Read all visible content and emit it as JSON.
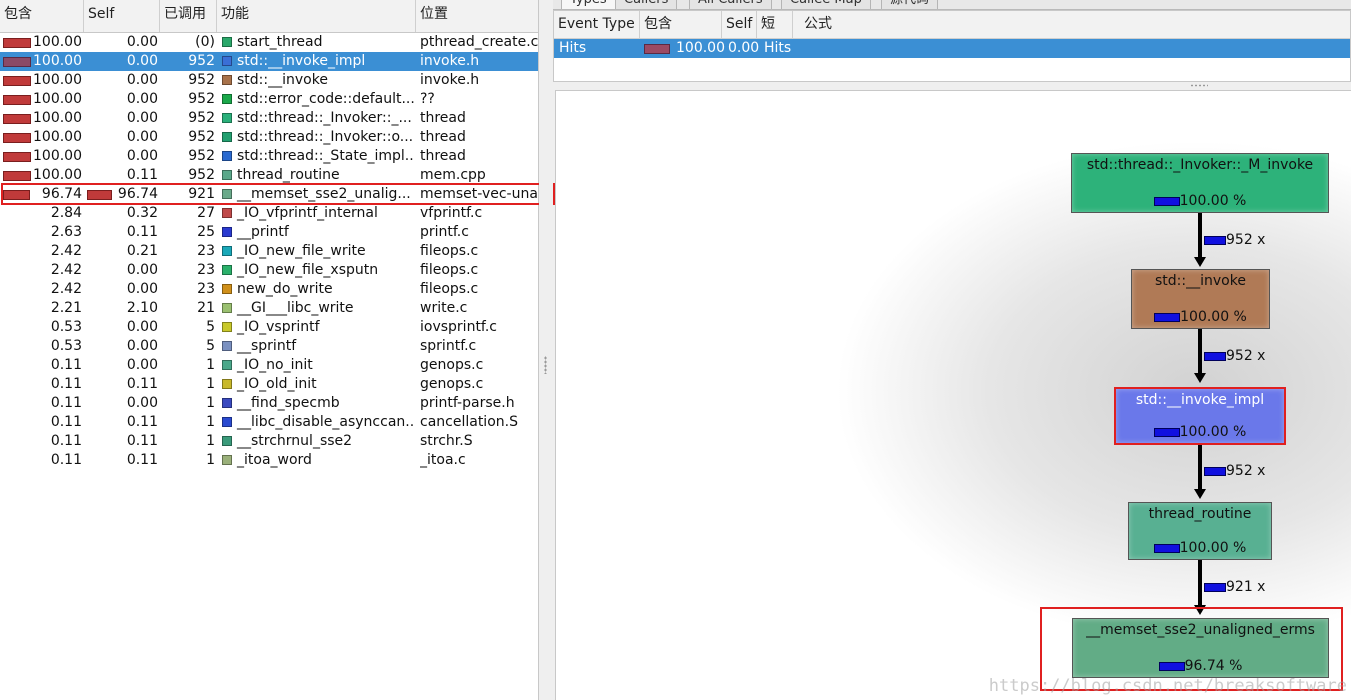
{
  "colors": {
    "selection": "#3b8fd4",
    "incl_bar": "#c03a3a",
    "cost_bar": "#1010e0",
    "highlight": "#e02020"
  },
  "flat_profile": {
    "columns": [
      "包含",
      "Self",
      "已调用",
      "功能",
      "位置"
    ],
    "rows": [
      {
        "incl": "100.00",
        "incl_bar": 1.0,
        "self": "0.00",
        "self_bar": 0,
        "calls": "(0)",
        "func": "start_thread",
        "loc": "pthread_create.c",
        "swatch": "#2aa86a"
      },
      {
        "incl": "100.00",
        "incl_bar": 1.0,
        "self": "0.00",
        "self_bar": 0,
        "calls": "952",
        "func": "std::__invoke_impl",
        "loc": "invoke.h",
        "swatch": "#3a6fd6",
        "selected": true
      },
      {
        "incl": "100.00",
        "incl_bar": 1.0,
        "self": "0.00",
        "self_bar": 0,
        "calls": "952",
        "func": "std::__invoke",
        "loc": "invoke.h",
        "swatch": "#a8724a"
      },
      {
        "incl": "100.00",
        "incl_bar": 1.0,
        "self": "0.00",
        "self_bar": 0,
        "calls": "952",
        "func": "std::error_code::default...",
        "loc": "??",
        "swatch": "#1aa84a"
      },
      {
        "incl": "100.00",
        "incl_bar": 1.0,
        "self": "0.00",
        "self_bar": 0,
        "calls": "952",
        "func": "std::thread::_Invoker::_...",
        "loc": "thread",
        "swatch": "#2ab07a"
      },
      {
        "incl": "100.00",
        "incl_bar": 1.0,
        "self": "0.00",
        "self_bar": 0,
        "calls": "952",
        "func": "std::thread::_Invoker::o...",
        "loc": "thread",
        "swatch": "#22a070"
      },
      {
        "incl": "100.00",
        "incl_bar": 1.0,
        "self": "0.00",
        "self_bar": 0,
        "calls": "952",
        "func": "std::thread::_State_impl...",
        "loc": "thread",
        "swatch": "#2a6ad0"
      },
      {
        "incl": "100.00",
        "incl_bar": 1.0,
        "self": "0.11",
        "self_bar": 0,
        "calls": "952",
        "func": "thread_routine",
        "loc": "mem.cpp",
        "swatch": "#5aa88a"
      },
      {
        "incl": "96.74",
        "incl_bar": 0.9674,
        "self": "96.74",
        "self_bar": 0.9674,
        "calls": "921",
        "func": "__memset_sse2_unalig...",
        "loc": "memset-vec-unali",
        "swatch": "#6aaa8a",
        "highlighted": true
      },
      {
        "incl": "2.84",
        "incl_bar": 0,
        "self": "0.32",
        "self_bar": 0,
        "calls": "27",
        "func": "_IO_vfprintf_internal",
        "loc": "vfprintf.c",
        "swatch": "#c04a4a"
      },
      {
        "incl": "2.63",
        "incl_bar": 0,
        "self": "0.11",
        "self_bar": 0,
        "calls": "25",
        "func": "__printf",
        "loc": "printf.c",
        "swatch": "#2a3ad0"
      },
      {
        "incl": "2.42",
        "incl_bar": 0,
        "self": "0.21",
        "self_bar": 0,
        "calls": "23",
        "func": "_IO_new_file_write",
        "loc": "fileops.c",
        "swatch": "#1aa8b8"
      },
      {
        "incl": "2.42",
        "incl_bar": 0,
        "self": "0.00",
        "self_bar": 0,
        "calls": "23",
        "func": "_IO_new_file_xsputn",
        "loc": "fileops.c",
        "swatch": "#2ab06a"
      },
      {
        "incl": "2.42",
        "incl_bar": 0,
        "self": "0.00",
        "self_bar": 0,
        "calls": "23",
        "func": "new_do_write",
        "loc": "fileops.c",
        "swatch": "#d0901a"
      },
      {
        "incl": "2.21",
        "incl_bar": 0,
        "self": "2.10",
        "self_bar": 0,
        "calls": "21",
        "func": "__GI___libc_write",
        "loc": "write.c",
        "swatch": "#9ac070"
      },
      {
        "incl": "0.53",
        "incl_bar": 0,
        "self": "0.00",
        "self_bar": 0,
        "calls": "5",
        "func": "_IO_vsprintf",
        "loc": "iovsprintf.c",
        "swatch": "#c8c82a"
      },
      {
        "incl": "0.53",
        "incl_bar": 0,
        "self": "0.00",
        "self_bar": 0,
        "calls": "5",
        "func": "__sprintf",
        "loc": "sprintf.c",
        "swatch": "#7a90c0"
      },
      {
        "incl": "0.11",
        "incl_bar": 0,
        "self": "0.00",
        "self_bar": 0,
        "calls": "1",
        "func": "_IO_no_init",
        "loc": "genops.c",
        "swatch": "#4aa88a"
      },
      {
        "incl": "0.11",
        "incl_bar": 0,
        "self": "0.11",
        "self_bar": 0,
        "calls": "1",
        "func": "_IO_old_init",
        "loc": "genops.c",
        "swatch": "#c8b82a"
      },
      {
        "incl": "0.11",
        "incl_bar": 0,
        "self": "0.00",
        "self_bar": 0,
        "calls": "1",
        "func": "__find_specmb",
        "loc": "printf-parse.h",
        "swatch": "#3a4ac0"
      },
      {
        "incl": "0.11",
        "incl_bar": 0,
        "self": "0.11",
        "self_bar": 0,
        "calls": "1",
        "func": "__libc_disable_asynccan...",
        "loc": "cancellation.S",
        "swatch": "#2a4ad0"
      },
      {
        "incl": "0.11",
        "incl_bar": 0,
        "self": "0.11",
        "self_bar": 0,
        "calls": "1",
        "func": "__strchrnul_sse2",
        "loc": "strchr.S",
        "swatch": "#3a9a7a"
      },
      {
        "incl": "0.11",
        "incl_bar": 0,
        "self": "0.11",
        "self_bar": 0,
        "calls": "1",
        "func": "_itoa_word",
        "loc": "_itoa.c",
        "swatch": "#9ab07a"
      }
    ]
  },
  "tabs": [
    {
      "label": "Types",
      "active": true
    },
    {
      "label": "Callers",
      "active": false
    },
    {
      "label": "All Callers",
      "active": false
    },
    {
      "label": "Callee Map",
      "active": false
    },
    {
      "label": "源代码",
      "active": false
    }
  ],
  "types_panel": {
    "columns": [
      "Event Type",
      "包含",
      "Self",
      "短",
      "公式"
    ],
    "row": {
      "event_type": "Hits",
      "incl": "100.00",
      "self": "0.00",
      "short": "Hits",
      "formula": ""
    }
  },
  "call_graph": {
    "nodes": [
      {
        "name": "std::thread::_Invoker::_M_invoke",
        "cost": "100.00 %",
        "color": "#2db27a",
        "selected": false
      },
      {
        "name": "std::__invoke",
        "cost": "100.00 %",
        "color": "#b07a56",
        "selected": false
      },
      {
        "name": "std::__invoke_impl",
        "cost": "100.00 %",
        "color": "#6a78ea",
        "selected": true
      },
      {
        "name": "thread_routine",
        "cost": "100.00 %",
        "color": "#58b092",
        "selected": false
      },
      {
        "name": "__memset_sse2_unaligned_erms",
        "cost": "96.74 %",
        "color": "#62ac86",
        "selected": false,
        "highlighted": true
      }
    ],
    "edges": [
      {
        "label": "952 x"
      },
      {
        "label": "952 x"
      },
      {
        "label": "952 x"
      },
      {
        "label": "921 x"
      }
    ],
    "watermark": "https://blog.csdn.net/breaksoftware"
  }
}
